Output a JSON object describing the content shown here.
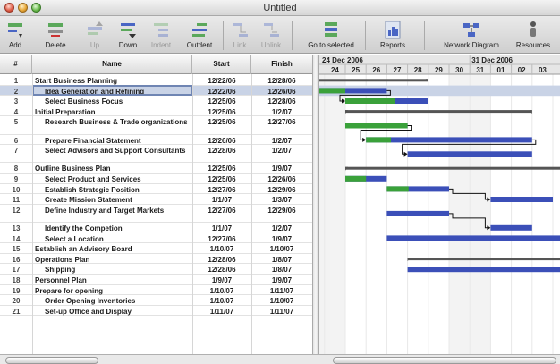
{
  "window": {
    "title": "Untitled"
  },
  "toolbar": {
    "add": "Add",
    "delete": "Delete",
    "up": "Up",
    "down": "Down",
    "indent": "Indent",
    "outdent": "Outdent",
    "link": "Link",
    "unlink": "Unlink",
    "go_to_selected": "Go to selected",
    "reports": "Reports",
    "network_diagram": "Network Diagram",
    "resources": "Resources"
  },
  "table": {
    "columns": {
      "num": "#",
      "name": "Name",
      "start": "Start",
      "finish": "Finish"
    },
    "rows": [
      {
        "num": "1",
        "name": "Start Business Planning",
        "start": "12/22/06",
        "finish": "12/28/06",
        "indent": 0
      },
      {
        "num": "2",
        "name": "Idea Generation and Refining",
        "start": "12/22/06",
        "finish": "12/26/06",
        "indent": 1,
        "selected": true
      },
      {
        "num": "3",
        "name": "Select Business Focus",
        "start": "12/25/06",
        "finish": "12/28/06",
        "indent": 1
      },
      {
        "num": "4",
        "name": "Initial Preparation",
        "start": "12/25/06",
        "finish": "1/2/07",
        "indent": 0
      },
      {
        "num": "5",
        "name": "Research Business & Trade organizations",
        "start": "12/25/06",
        "finish": "12/27/06",
        "indent": 1,
        "tall": true
      },
      {
        "num": "6",
        "name": "Prepare Financial Statement",
        "start": "12/26/06",
        "finish": "1/2/07",
        "indent": 1
      },
      {
        "num": "7",
        "name": "Select Advisors and Support Consultants",
        "start": "12/28/06",
        "finish": "1/2/07",
        "indent": 1,
        "tall": true
      },
      {
        "num": "8",
        "name": "Outline Business Plan",
        "start": "12/25/06",
        "finish": "1/9/07",
        "indent": 0
      },
      {
        "num": "9",
        "name": "Select Product and Services",
        "start": "12/25/06",
        "finish": "12/26/06",
        "indent": 1
      },
      {
        "num": "10",
        "name": "Establish Strategic Position",
        "start": "12/27/06",
        "finish": "12/29/06",
        "indent": 1
      },
      {
        "num": "11",
        "name": "Create Mission Statement",
        "start": "1/1/07",
        "finish": "1/3/07",
        "indent": 1
      },
      {
        "num": "12",
        "name": "Define Industry and Target Markets",
        "start": "12/27/06",
        "finish": "12/29/06",
        "indent": 1,
        "tall": true
      },
      {
        "num": "13",
        "name": "Identify the Competion",
        "start": "1/1/07",
        "finish": "1/2/07",
        "indent": 1
      },
      {
        "num": "14",
        "name": "Select a Location",
        "start": "12/27/06",
        "finish": "1/9/07",
        "indent": 1
      },
      {
        "num": "15",
        "name": "Establish an Advisory Board",
        "start": "1/10/07",
        "finish": "1/10/07",
        "indent": 0
      },
      {
        "num": "16",
        "name": "Operations Plan",
        "start": "12/28/06",
        "finish": "1/8/07",
        "indent": 0
      },
      {
        "num": "17",
        "name": "Shipping",
        "start": "12/28/06",
        "finish": "1/8/07",
        "indent": 1
      },
      {
        "num": "18",
        "name": "Personnel Plan",
        "start": "1/9/07",
        "finish": "1/9/07",
        "indent": 0
      },
      {
        "num": "19",
        "name": "Prepare for opening",
        "start": "1/10/07",
        "finish": "1/11/07",
        "indent": 0
      },
      {
        "num": "20",
        "name": "Order Opening Inventories",
        "start": "1/10/07",
        "finish": "1/10/07",
        "indent": 1
      },
      {
        "num": "21",
        "name": "Set-up Office and Display",
        "start": "1/11/07",
        "finish": "1/11/07",
        "indent": 1
      }
    ]
  },
  "gantt": {
    "weeks": [
      "24 Dec 2006",
      "31 Dec 2006"
    ],
    "days": [
      "24",
      "25",
      "26",
      "27",
      "28",
      "29",
      "30",
      "31",
      "01",
      "02",
      "03"
    ],
    "colors": {
      "summary": "#555555",
      "complete": "#3aa13a",
      "remaining": "#3b4fb8",
      "grid": "#e8e8e8",
      "weekend": "#f3f3f3"
    },
    "tasks": [
      {
        "row": 1,
        "kind": "summary",
        "start": "12/22/06",
        "finish": "12/28/06"
      },
      {
        "row": 2,
        "kind": "task",
        "start": "12/22/06",
        "finish": "12/26/06",
        "percent_complete": 60
      },
      {
        "row": 3,
        "kind": "task",
        "start": "12/25/06",
        "finish": "12/28/06",
        "percent_complete": 60
      },
      {
        "row": 4,
        "kind": "summary",
        "start": "12/25/06",
        "finish": "1/2/07"
      },
      {
        "row": 5,
        "kind": "task",
        "start": "12/25/06",
        "finish": "12/27/06",
        "percent_complete": 100
      },
      {
        "row": 6,
        "kind": "task",
        "start": "12/26/06",
        "finish": "1/2/07",
        "percent_complete": 15
      },
      {
        "row": 7,
        "kind": "task",
        "start": "12/28/06",
        "finish": "1/2/07",
        "percent_complete": 0
      },
      {
        "row": 8,
        "kind": "summary",
        "start": "12/25/06",
        "finish": "1/9/07"
      },
      {
        "row": 9,
        "kind": "task",
        "start": "12/25/06",
        "finish": "12/26/06",
        "percent_complete": 50
      },
      {
        "row": 10,
        "kind": "task",
        "start": "12/27/06",
        "finish": "12/29/06",
        "percent_complete": 35
      },
      {
        "row": 11,
        "kind": "task",
        "start": "1/1/07",
        "finish": "1/3/07",
        "percent_complete": 0
      },
      {
        "row": 12,
        "kind": "task",
        "start": "12/27/06",
        "finish": "12/29/06",
        "percent_complete": 0
      },
      {
        "row": 13,
        "kind": "task",
        "start": "1/1/07",
        "finish": "1/2/07",
        "percent_complete": 0
      },
      {
        "row": 14,
        "kind": "task",
        "start": "12/27/06",
        "finish": "1/9/07",
        "percent_complete": 0
      },
      {
        "row": 16,
        "kind": "summary",
        "start": "12/28/06",
        "finish": "1/8/07"
      },
      {
        "row": 17,
        "kind": "task",
        "start": "12/28/06",
        "finish": "1/8/07",
        "percent_complete": 0
      }
    ],
    "links": [
      [
        2,
        3
      ],
      [
        5,
        6
      ],
      [
        6,
        7
      ],
      [
        10,
        11
      ],
      [
        12,
        13
      ]
    ]
  }
}
